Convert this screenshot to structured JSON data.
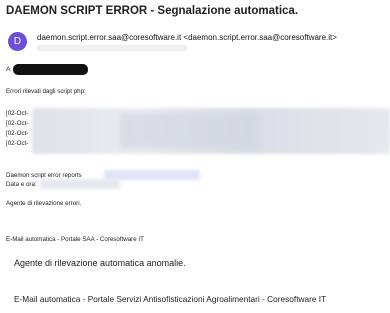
{
  "email": {
    "subject": "DAEMON SCRIPT ERROR - Segnalazione automatica.",
    "avatar_letter": "D",
    "sender": "daemon.script.error.saa@coresoftware.it <daemon.script.error.saa@coresoftware.it>",
    "to_label": "A",
    "body": {
      "errors_title": "Errori rilevati dagli script php:",
      "error_rows": [
        "[02-Oct-",
        "[02-Oct-",
        "[02-Oct-",
        "[02-Oct-"
      ],
      "daemon_label": "Daemon script error reports",
      "date_label": "Data e ora:",
      "agent_small": "Agente di rilevazione errori.",
      "email_small": "E-Mail automatica - Portale SAA - Coresoftware IT",
      "agent_big": "Agente di rilevazione automatica anomalie.",
      "email_big": "E-Mail automatica - Portale Servizi Antisofisticazioni Agroalimentari - Coresoftware IT"
    }
  }
}
